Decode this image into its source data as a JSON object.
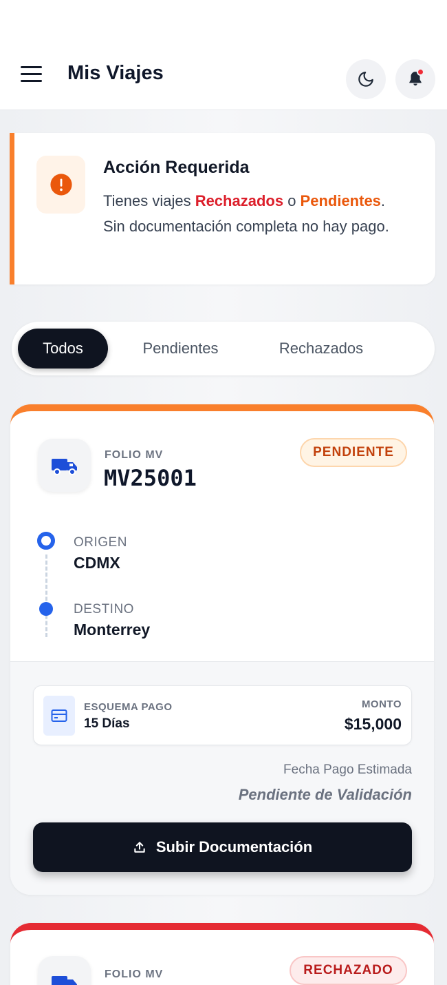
{
  "header": {
    "title": "Mis Viajes",
    "menu_icon": "hamburger-icon",
    "theme_icon": "moon-icon",
    "notification_icon": "bell-icon"
  },
  "alert": {
    "icon": "exclamation-icon",
    "title": "Acción Requerida",
    "text_prefix": "Tienes viajes ",
    "rejected": "Rechazados",
    "connector": " o ",
    "pending": "Pendientes",
    "text_suffix": ".",
    "text_line2": "Sin documentación completa no hay pago."
  },
  "tabs": [
    {
      "label": "Todos",
      "active": true
    },
    {
      "label": "Pendientes",
      "active": false
    },
    {
      "label": "Rechazados",
      "active": false
    }
  ],
  "trips": [
    {
      "status": "PENDIENTE",
      "status_color": "#f97f2c",
      "folio_label": "FOLIO MV",
      "folio": "MV25001",
      "origin_label": "ORIGEN",
      "origin": "CDMX",
      "destination_label": "DESTINO",
      "destination": "Monterrey",
      "payment_scheme_label": "ESQUEMA PAGO",
      "payment_scheme": "15 Días",
      "amount_label": "MONTO",
      "amount": "$15,000",
      "estimated_date_label": "Fecha Pago Estimada",
      "estimated_date": "Pendiente de Validación",
      "action_label": "Subir Documentación"
    },
    {
      "status": "RECHAZADO",
      "status_color": "#e52b33",
      "folio_label": "FOLIO MV"
    }
  ],
  "colors": {
    "accent_dark": "#0f1420",
    "pending": "#f97f2c",
    "rejected": "#e52b33",
    "primary_blue": "#2563eb"
  }
}
